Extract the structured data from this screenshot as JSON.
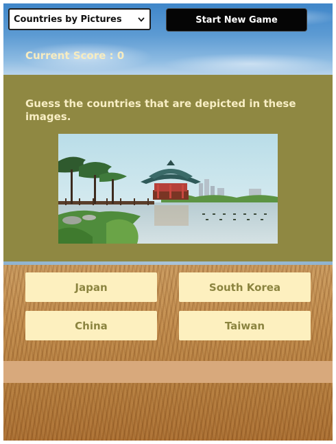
{
  "header": {
    "category_select": {
      "selected": "Countries by Pictures",
      "icon": "chevron-down-icon"
    },
    "start_button_label": "Start New Game",
    "score_text": "Current Score : 0"
  },
  "question": {
    "prompt": "Guess the countries that are depicted in these images.",
    "image_description_icon": "pagoda-lake-photo"
  },
  "answers": [
    {
      "label": "Japan"
    },
    {
      "label": "South Korea"
    },
    {
      "label": "China"
    },
    {
      "label": "Taiwan"
    }
  ],
  "colors": {
    "panel": "#8f8842",
    "answer_bg": "#fdf0bf",
    "answer_text": "#8b8440",
    "feedback_bar": "#d8a97c",
    "start_button_bg": "#050505"
  }
}
